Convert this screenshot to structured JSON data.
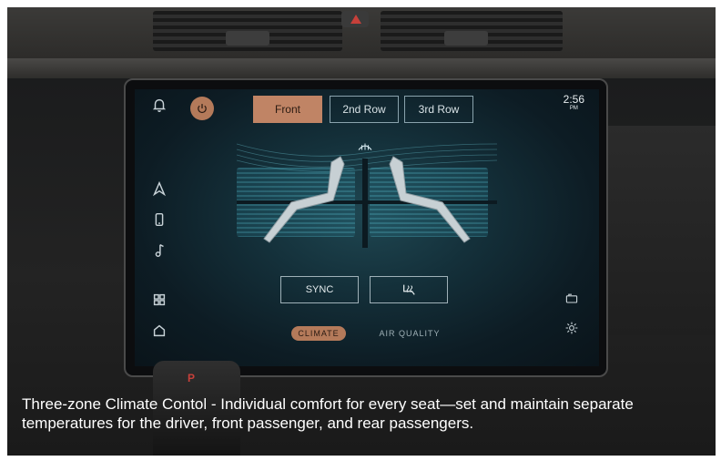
{
  "screen": {
    "clock": {
      "time": "2:56",
      "period": "PM"
    },
    "tabs": [
      {
        "label": "Front",
        "active": true
      },
      {
        "label": "2nd Row",
        "active": false
      },
      {
        "label": "3rd Row",
        "active": false
      }
    ],
    "sidebar_icons": [
      "bell-icon",
      "navigation-icon",
      "phone-icon",
      "music-icon",
      "apps-grid-icon",
      "home-icon"
    ],
    "right_icons": [
      "camera-icon",
      "settings-icon"
    ],
    "controls": {
      "sync_label": "SYNC",
      "seat_heat_icon": "seat-heat-icon",
      "defrost_icon": "defrost-icon"
    },
    "bottom_tabs": [
      {
        "label": "CLIMATE",
        "active": true
      },
      {
        "label": "AIR QUALITY",
        "active": false
      }
    ],
    "accent_color": "#c08465"
  },
  "shifter": {
    "gear": "P"
  },
  "caption": "Three-zone Climate Contol - Individual comfort for every seat—set and maintain separate temperatures for the driver, front passenger, and rear passengers."
}
